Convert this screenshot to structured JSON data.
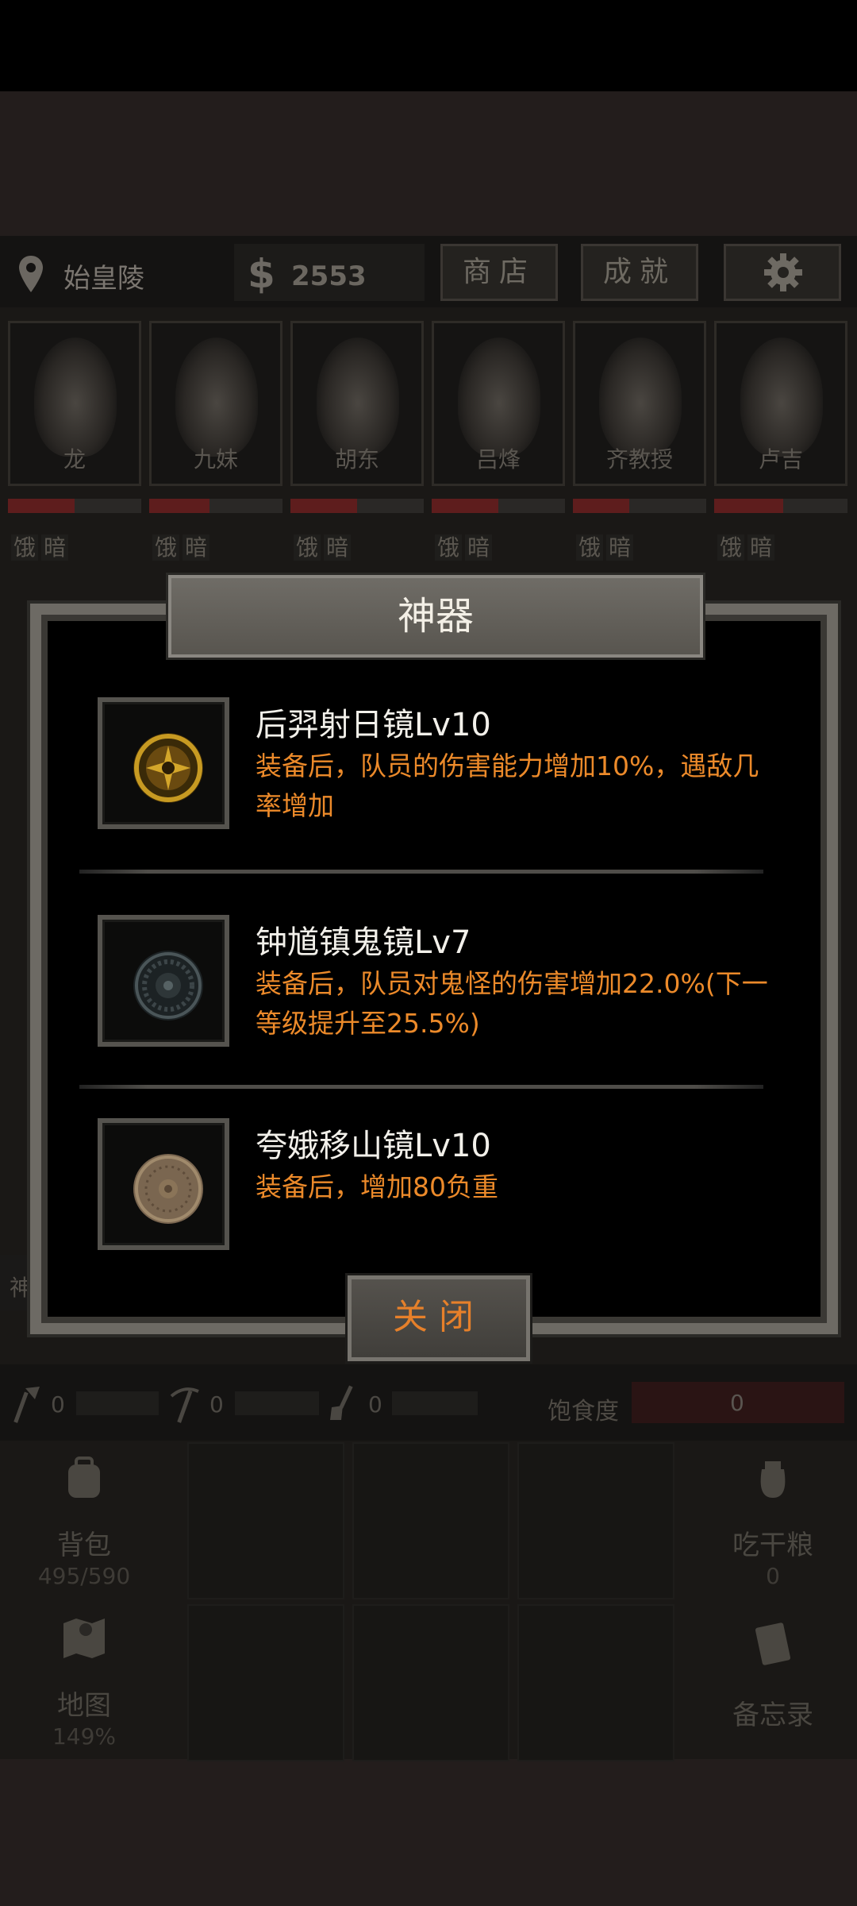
{
  "location": {
    "name": "始皇陵",
    "money_symbol": "$",
    "money": "2553"
  },
  "top_buttons": {
    "shop": "商店",
    "achievements": "成就"
  },
  "characters": [
    {
      "name": "龙",
      "status1": "饿",
      "status2": "暗",
      "hp": 0.5
    },
    {
      "name": "九妹",
      "status1": "饿",
      "status2": "暗",
      "hp": 0.45
    },
    {
      "name": "胡东",
      "status1": "饿",
      "status2": "暗",
      "hp": 0.5
    },
    {
      "name": "吕烽",
      "status1": "饿",
      "status2": "暗",
      "hp": 0.5
    },
    {
      "name": "齐教授",
      "status1": "饿",
      "status2": "暗",
      "hp": 0.42
    },
    {
      "name": "卢吉",
      "status1": "饿",
      "status2": "暗",
      "hp": 0.52
    }
  ],
  "side_tab": "神",
  "tools": {
    "tool1": "0",
    "tool2": "0",
    "tool3": "0",
    "satiety_label": "饱食度",
    "satiety_value": "0"
  },
  "panel": {
    "backpack": "背包",
    "backpack_count": "495/590",
    "eat": "吃干粮",
    "eat_count": "0",
    "map": "地图",
    "map_percent": "149%",
    "memo": "备忘录"
  },
  "dialog": {
    "title": "神器",
    "items": [
      {
        "name": "后羿射日镜Lv10",
        "desc": "装备后，队员的伤害能力增加10%，遇敌几率增加"
      },
      {
        "name": "钟馗镇鬼镜Lv7",
        "desc": "装备后，队员对鬼怪的伤害增加22.0%(下一等级提升至25.5%)"
      },
      {
        "name": "夸娥移山镜Lv10",
        "desc": "装备后，增加80负重"
      }
    ],
    "close_label": "关闭"
  }
}
